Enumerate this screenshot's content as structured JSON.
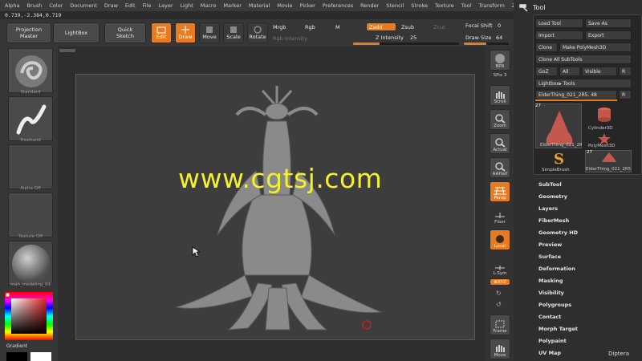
{
  "menu": [
    "Alpha",
    "Brush",
    "Color",
    "Document",
    "Draw",
    "Edit",
    "File",
    "Layer",
    "Light",
    "Macro",
    "Marker",
    "Material",
    "Movie",
    "Picker",
    "Preferences",
    "Render",
    "Stencil",
    "Stroke",
    "Texture",
    "Tool",
    "Transform",
    "Zplugin",
    "Zscript"
  ],
  "coordinates": "0.739,-2.384,0.719",
  "toolbar": {
    "projection_master": "Projection\nMaster",
    "lightbox": "LightBox",
    "quick_sketch": "Quick\nSketch",
    "edit": "Edit",
    "draw": "Draw",
    "move": "Move",
    "scale": "Scale",
    "rotate": "Rotate",
    "mrgb": "Mrgb",
    "rgb": "Rgb",
    "m": "M",
    "zadd": "Zadd",
    "zsub": "Zsub",
    "zcut": "Zcut",
    "rgb_intensity": "Rgb Intensity",
    "z_intensity_label": "Z Intensity",
    "z_intensity_value": "25",
    "focal_shift_label": "Focal Shift",
    "focal_shift_value": "0",
    "draw_size_label": "Draw Size",
    "draw_size_value": "64",
    "z_intensity_level": 0.25,
    "draw_size_level": 0.5
  },
  "left_panel": {
    "brush_label": "Standard",
    "stroke_label": "Freehand",
    "alpha_label": "Alpha Off",
    "texture_label": "Texture Off",
    "material_label": "mah_modeling_01",
    "gradient_label": "Gradient"
  },
  "watermark": "www.cgtsj.com",
  "right_strip": {
    "bpr": "BPR",
    "spix_label": "SPix",
    "spix_value": "3",
    "scroll": "Scroll",
    "zoom": "Zoom",
    "actual": "Actual",
    "aahalf": "AAHalf",
    "persp": "Persp",
    "floor": "Floor",
    "local": "Local",
    "lsym": "L.Sym",
    "xyz": "⊕XYZ",
    "frame": "Frame",
    "move": "Move"
  },
  "tool_panel": {
    "title": "Tool",
    "load_tool": "Load Tool",
    "save_as": "Save As",
    "import": "Import",
    "export": "Export",
    "clone": "Clone",
    "make_polymesh": "Make PolyMesh3D",
    "clone_all": "Clone All SubTools",
    "goz": "GoZ",
    "all": "All",
    "visible": "Visible",
    "r": "R",
    "lightbox_tools": "Lightbox▸ Tools",
    "current_tool": "ElderThing_021_2R5. 48",
    "thumb_count1": "27",
    "thumb_count2": "27",
    "thumb1_label": "ElderThing_021_2R5",
    "thumb2_label": "Cylinder3D",
    "thumb3_label": "PolyMesh3D",
    "thumb4_label": "SimpleBrush",
    "thumb5_label": "ElderThing_021_2R5",
    "subpalettes": [
      "SubTool",
      "Geometry",
      "Layers",
      "FiberMesh",
      "Geometry HD",
      "Preview",
      "Surface",
      "Deformation",
      "Masking",
      "Visibility",
      "Polygroups",
      "Contact",
      "Morph Target",
      "Polypaint",
      "UV Map"
    ]
  },
  "footer_label": "Diptera",
  "colors": {
    "accent": "#e87b1f",
    "watermark": "#f4f12a"
  }
}
